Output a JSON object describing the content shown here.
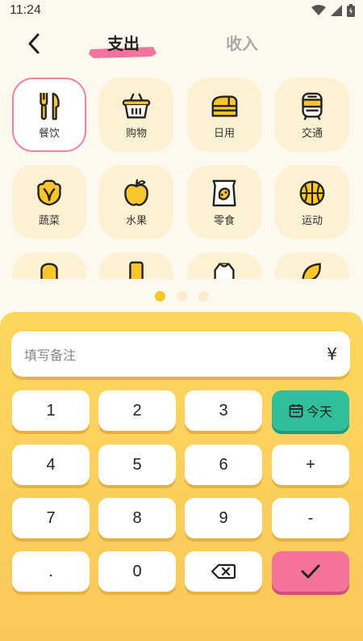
{
  "status_bar": {
    "time": "11:24"
  },
  "header": {
    "tab_expense": "支出",
    "tab_income": "收入"
  },
  "categories": [
    {
      "label": "餐饮",
      "icon": "fork-knife-icon",
      "selected": true
    },
    {
      "label": "购物",
      "icon": "basket-icon"
    },
    {
      "label": "日用",
      "icon": "bread-icon"
    },
    {
      "label": "交通",
      "icon": "train-icon"
    },
    {
      "label": "蔬菜",
      "icon": "cabbage-icon"
    },
    {
      "label": "水果",
      "icon": "apple-icon"
    },
    {
      "label": "零食",
      "icon": "snack-bag-icon"
    },
    {
      "label": "运动",
      "icon": "basketball-icon"
    }
  ],
  "pager": {
    "pages": 3,
    "active": 1
  },
  "keypad": {
    "note_placeholder": "填写备注",
    "currency": "¥",
    "keys": {
      "k1": "1",
      "k2": "2",
      "k3": "3",
      "k4": "4",
      "k5": "5",
      "k6": "6",
      "k7": "7",
      "k8": "8",
      "k9": "9",
      "dot": ".",
      "k0": "0",
      "plus": "+",
      "minus": "-",
      "today": "今天"
    }
  },
  "colors": {
    "accent_pink": "#f5739b",
    "accent_green": "#2fbf9b",
    "accent_yellow": "#fdd75d",
    "tile_bg": "#fcf1d3"
  }
}
